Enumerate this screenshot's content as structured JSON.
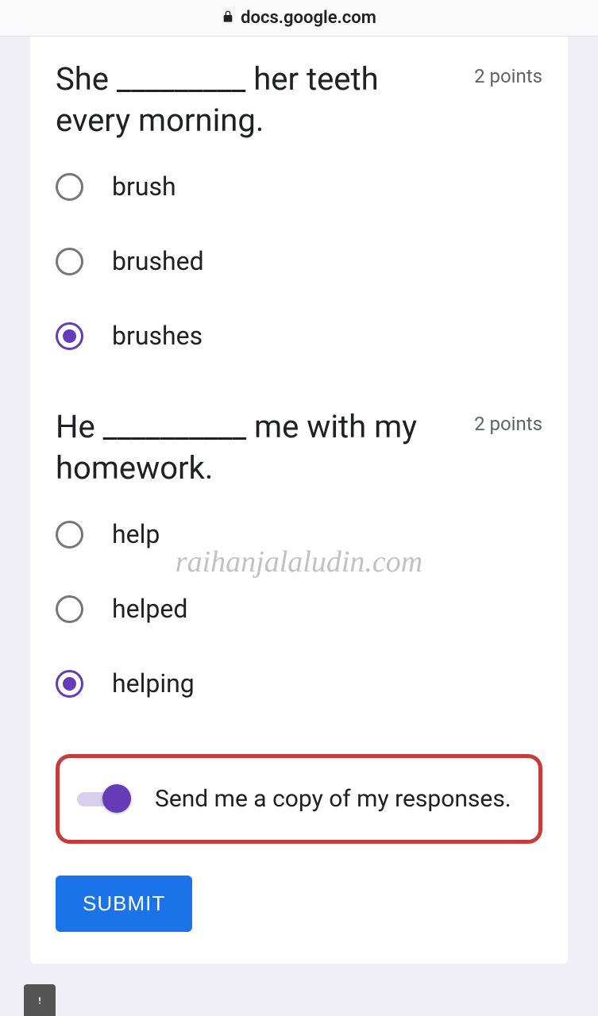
{
  "browser": {
    "url": "docs.google.com"
  },
  "watermark_text": "raihanjalaludin.com",
  "questions": [
    {
      "title": "She _________ her teeth every morning.",
      "points": "2 points",
      "options": [
        "brush",
        "brushed",
        "brushes"
      ],
      "selected": 2
    },
    {
      "title": "He __________ me with my homework.",
      "points": "2 points",
      "options": [
        "help",
        "helped",
        "helping"
      ],
      "selected": 2
    }
  ],
  "copy_toggle": {
    "label": "Send me a copy of my responses.",
    "on": true
  },
  "submit_label": "SUBMIT"
}
